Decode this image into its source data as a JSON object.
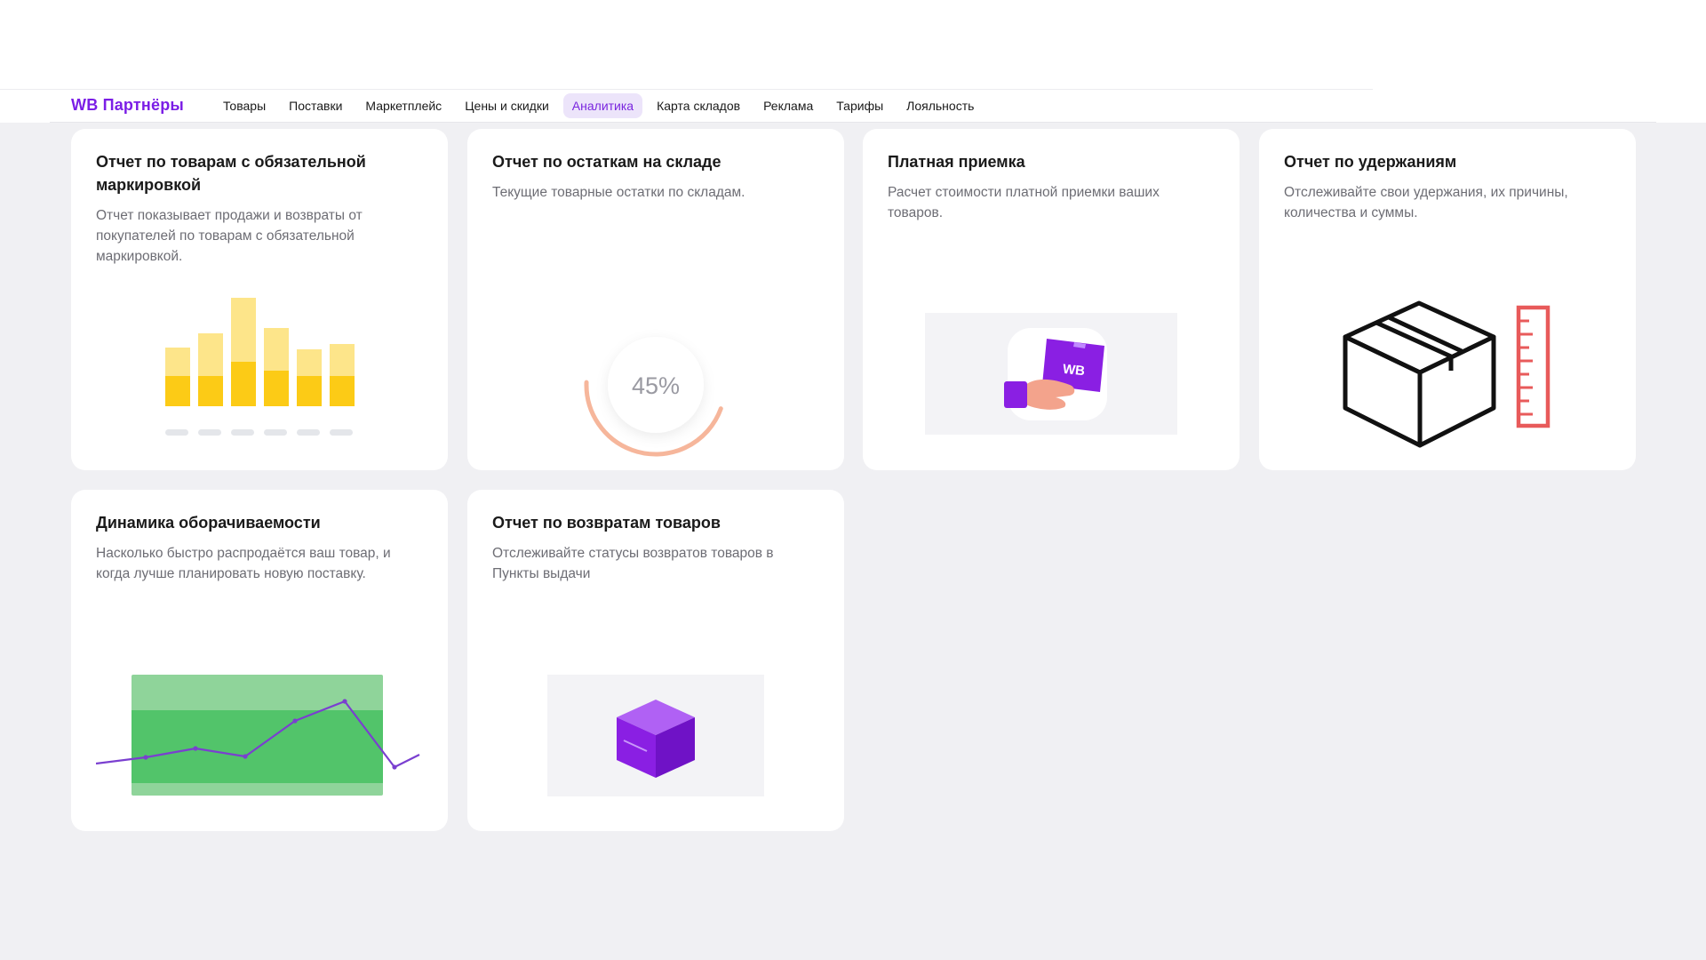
{
  "header": {
    "logo": "WB Партнёры",
    "nav": [
      {
        "label": "Товары",
        "active": false
      },
      {
        "label": "Поставки",
        "active": false
      },
      {
        "label": "Маркетплейс",
        "active": false
      },
      {
        "label": "Цены и скидки",
        "active": false
      },
      {
        "label": "Аналитика",
        "active": true
      },
      {
        "label": "Карта складов",
        "active": false
      },
      {
        "label": "Реклама",
        "active": false
      },
      {
        "label": "Тарифы",
        "active": false
      },
      {
        "label": "Лояльность",
        "active": false
      }
    ]
  },
  "cards": [
    {
      "title": "Отчет по товарам с обязательной маркировкой",
      "description": "Отчет показывает продажи и возвраты от покупателей по товарам с обязательной маркировкой.",
      "illustration": "bar-chart-illustration"
    },
    {
      "title": "Отчет по остаткам на складе",
      "description": "Текущие товарные остатки по складам.",
      "illustration": "progress-ring-illustration",
      "progress_label": "45%",
      "progress_value": 45
    },
    {
      "title": "Платная приемка",
      "description": "Расчет стоимости платной приемки ваших товаров.",
      "illustration": "hand-with-box-illustration",
      "box_label": "WB"
    },
    {
      "title": "Отчет по удержаниям",
      "description": "Отслеживайте свои удержания, их причины, количества и суммы.",
      "illustration": "box-and-ruler-illustration"
    },
    {
      "title": "Динамика оборачиваемости",
      "description": "Насколько быстро распродаётся ваш товар, и когда лучше планировать новую поставку.",
      "illustration": "line-chart-illustration"
    },
    {
      "title": "Отчет по возвратам товаров",
      "description": "Отслеживайте статусы возвратов товаров в Пункты выдачи",
      "illustration": "return-box-illustration"
    }
  ],
  "colors": {
    "brand": "#7b1ee6",
    "nav_active_bg": "#ece4fa",
    "bar_dark": "#fccb16",
    "bar_light": "#fde58a",
    "ring": "#f4a98a",
    "chart_band": "#52c46a",
    "chart_line": "#7a3fd0",
    "ruler": "#e85a5a"
  }
}
